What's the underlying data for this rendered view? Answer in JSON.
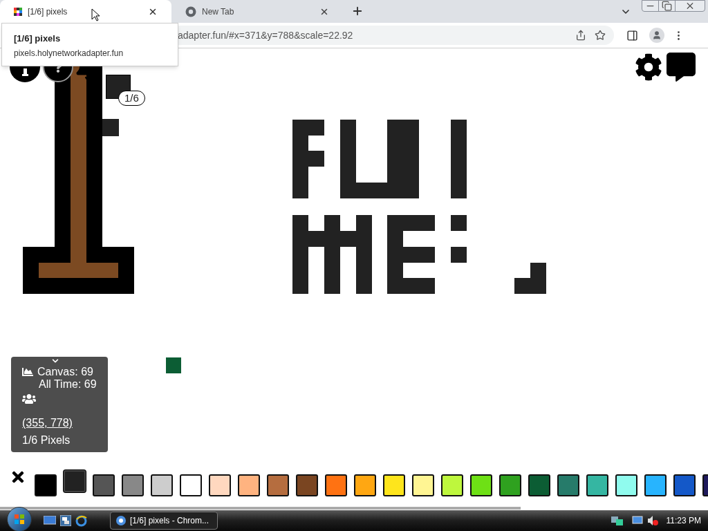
{
  "browser": {
    "tabs": [
      {
        "title": "[1/6] pixels",
        "selected": true
      },
      {
        "title": "New Tab",
        "selected": false
      }
    ],
    "address": "adapter.fun/#x=371&y=788&scale=22.92",
    "tooltip": {
      "title": "[1/6] pixels",
      "url": "pixels.holynetworkadapter.fun"
    }
  },
  "canvas": {
    "cursor_badge": "1/6"
  },
  "stats": {
    "canvas": "Canvas: 69",
    "all_time": "All Time: 69",
    "coords": "(355, 778)",
    "pixels": "1/6 Pixels"
  },
  "palette": [
    {
      "color": "#000000",
      "selected": false
    },
    {
      "color": "#222222",
      "selected": true
    },
    {
      "color": "#555555",
      "selected": false
    },
    {
      "color": "#888888",
      "selected": false
    },
    {
      "color": "#cdcdcd",
      "selected": false
    },
    {
      "color": "#ffffff",
      "selected": false
    },
    {
      "color": "#ffd8bf",
      "selected": false
    },
    {
      "color": "#ffb380",
      "selected": false
    },
    {
      "color": "#b56d3f",
      "selected": false
    },
    {
      "color": "#7a4521",
      "selected": false
    },
    {
      "color": "#ff7212",
      "selected": false
    },
    {
      "color": "#ffa712",
      "selected": false
    },
    {
      "color": "#fee51c",
      "selected": false
    },
    {
      "color": "#fff593",
      "selected": false
    },
    {
      "color": "#bef73d",
      "selected": false
    },
    {
      "color": "#6ee015",
      "selected": false
    },
    {
      "color": "#2fa11f",
      "selected": false
    },
    {
      "color": "#0c5d34",
      "selected": false
    },
    {
      "color": "#267b6a",
      "selected": false
    },
    {
      "color": "#35b6a2",
      "selected": false
    },
    {
      "color": "#90fbee",
      "selected": false
    },
    {
      "color": "#28b4fe",
      "selected": false
    },
    {
      "color": "#1458c8",
      "selected": false
    },
    {
      "color": "#1f1a5c",
      "selected": false
    }
  ],
  "taskbar": {
    "task": "[1/6] pixels - Chrom...",
    "clock": "11:23 PM"
  }
}
